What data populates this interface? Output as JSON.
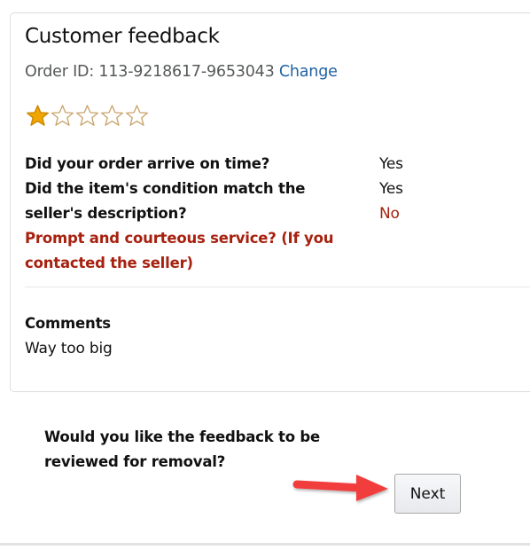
{
  "feedback": {
    "title": "Customer feedback",
    "order_label": "Order ID: 113-9218617-9653043",
    "change_link": "Change",
    "rating": {
      "value": 1,
      "max": 5,
      "filled_color": "#f0a500",
      "empty_color": "#c9a36a",
      "icon": "star-icon"
    },
    "questions": [
      {
        "text": "Did your order arrive on time?",
        "answer": "Yes",
        "highlight": false
      },
      {
        "text": "Did the item's condition match the seller's description?",
        "answer": "Yes",
        "highlight": false
      },
      {
        "text": "Prompt and courteous service? (If you contacted the seller)",
        "answer": "No",
        "highlight": true
      }
    ],
    "comments_label": "Comments",
    "comments_text": "Way too big"
  },
  "removal": {
    "question": "Would you like the feedback to be reviewed for removal?",
    "next_label": "Next",
    "annotation_icon": "red-arrow-icon"
  },
  "colors": {
    "link": "#2162a1",
    "alert_red": "#a7210f",
    "annotation_red": "#f23c3c"
  }
}
